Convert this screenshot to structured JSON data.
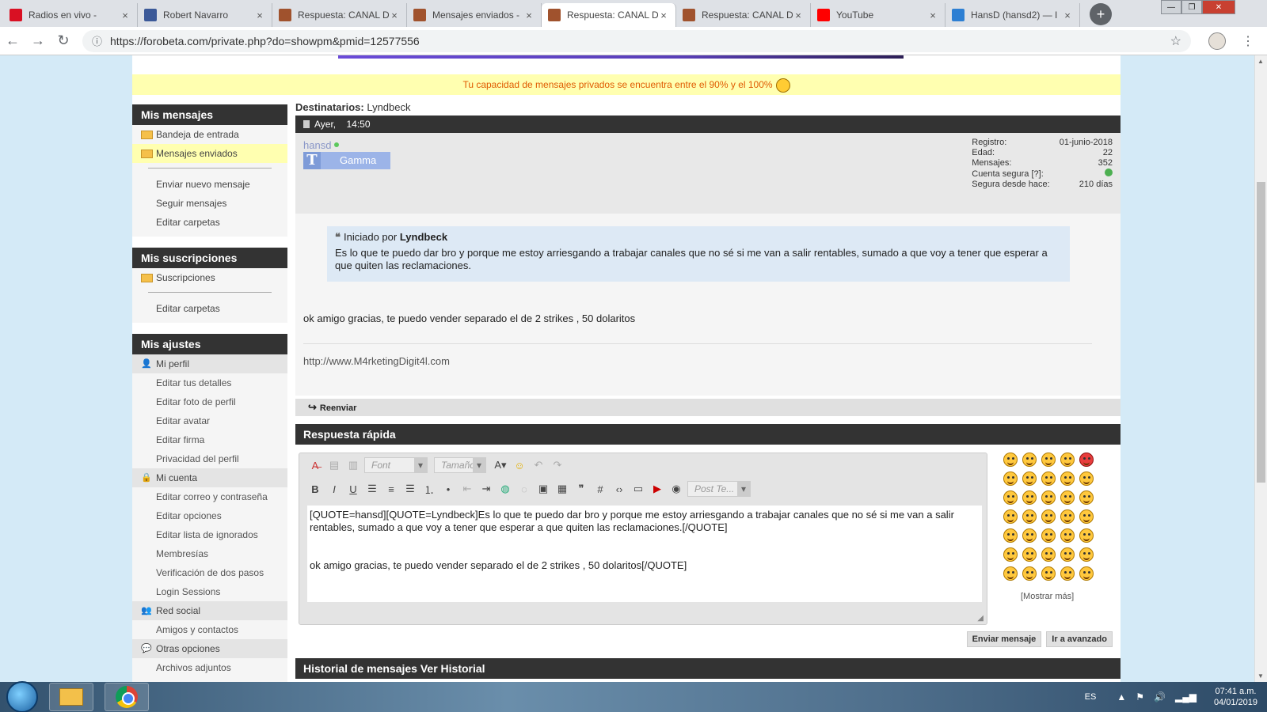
{
  "browser": {
    "tabs": [
      {
        "label": "Radios en vivo -",
        "icon": "peru-flag-icon",
        "color": "#d91023"
      },
      {
        "label": "Robert Navarro",
        "icon": "facebook-icon",
        "color": "#3b5998"
      },
      {
        "label": "Respuesta: CANAL D",
        "icon": "forobeta-icon",
        "color": "#a0522d"
      },
      {
        "label": "Mensajes enviados -",
        "icon": "forobeta-icon",
        "color": "#a0522d"
      },
      {
        "label": "Respuesta: CANAL D",
        "icon": "forobeta-icon",
        "color": "#a0522d"
      },
      {
        "label": "Respuesta: CANAL D",
        "icon": "forobeta-icon",
        "color": "#a0522d"
      },
      {
        "label": "YouTube",
        "icon": "youtube-icon",
        "color": "#ff0000"
      },
      {
        "label": "HansD (hansd2) — I",
        "icon": "ibb-icon",
        "color": "#2d7fd3"
      }
    ],
    "active_tab": 4,
    "url": "https://forobeta.com/private.php?do=showpm&pmid=12577556"
  },
  "notice": "Tu capacidad de mensajes privados se encuentra entre el 90% y el 100%",
  "sidebar": {
    "mis_mensajes": {
      "title": "Mis mensajes",
      "folders": [
        "Bandeja de entrada",
        "Mensajes enviados"
      ],
      "links": [
        "Enviar nuevo mensaje",
        "Seguir mensajes",
        "Editar carpetas"
      ]
    },
    "mis_suscripciones": {
      "title": "Mis suscripciones",
      "folders": [
        "Suscripciones"
      ],
      "links": [
        "Editar carpetas"
      ]
    },
    "mis_ajustes": {
      "title": "Mis ajustes",
      "mi_perfil": "Mi perfil",
      "perfil_links": [
        "Editar tus detalles",
        "Editar foto de perfil",
        "Editar avatar",
        "Editar firma",
        "Privacidad del perfil"
      ],
      "mi_cuenta": "Mi cuenta",
      "cuenta_links": [
        "Editar correo y contraseña",
        "Editar opciones",
        "Editar lista de ignorados",
        "Membresías",
        "Verificación de dos pasos",
        "Login Sessions"
      ],
      "red_social": "Red social",
      "red_links": [
        "Amigos y contactos"
      ],
      "otras": "Otras opciones",
      "otras_links": [
        "Archivos adjuntos"
      ]
    }
  },
  "message": {
    "dest_label": "Destinatarios:",
    "dest_value": "Lyndbeck",
    "date": "Ayer,",
    "time": "14:50",
    "username": "hansd",
    "rank_letter": "T",
    "rank": "Gamma",
    "stats": [
      {
        "label": "Registro:",
        "value": "01-junio-2018"
      },
      {
        "label": "Edad:",
        "value": "22"
      },
      {
        "label": "Mensajes:",
        "value": "352"
      },
      {
        "label": "Cuenta segura [?]:",
        "value": ""
      },
      {
        "label": "Segura desde hace:",
        "value": "210 días"
      }
    ],
    "quote_started_by": "Iniciado por",
    "quote_author": "Lyndbeck",
    "quote_text": "Es lo que te puedo dar bro y porque me estoy arriesgando a trabajar canales que no sé si me van a salir rentables, sumado a que voy a tener que esperar a que quiten las reclamaciones.",
    "body": "ok amigo gracias, te puedo vender separado el de 2 strikes , 50 dolaritos",
    "signature_link": "http://www.M4rketingDigit4l.com",
    "forward": "Reenviar"
  },
  "quick_reply": {
    "title": "Respuesta rápida",
    "font_placeholder": "Font",
    "size_placeholder": "Tamaño",
    "post_template": "Post Te...",
    "text_line1": "[QUOTE=hansd][QUOTE=Lyndbeck]Es lo que te puedo dar bro y porque me estoy arriesgando a trabajar canales que no sé si me van a salir rentables, sumado a que voy a tener que esperar a que quiten las reclamaciones.[/QUOTE]",
    "text_line2": "ok amigo gracias, te puedo vender separado el de 2 strikes , 50 dolaritos[/QUOTE]",
    "show_more": "[Mostrar más]",
    "send_button": "Enviar mensaje",
    "advanced_button": "Ir a avanzado"
  },
  "history": {
    "title": "Historial de mensajes Ver Historial"
  },
  "taskbar": {
    "lang": "ES",
    "time": "07:41 a.m.",
    "date": "04/01/2019"
  }
}
